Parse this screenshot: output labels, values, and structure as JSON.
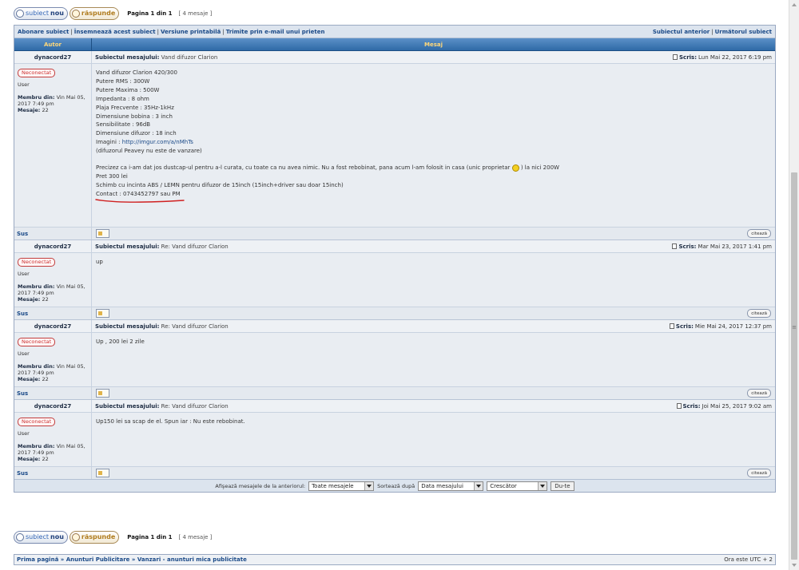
{
  "buttons": {
    "new_topic_w1": "subiect",
    "new_topic_w2": "nou",
    "reply": "răspunde"
  },
  "pagination": "Pagina 1 din 1",
  "message_count": "[ 4 mesaje ]",
  "nav": {
    "subscribe": "Abonare subiect",
    "bookmark": "Însemnează acest subiect",
    "printable": "Versiune printabilă",
    "email": "Trimite prin e-mail unui prieten",
    "prev": "Subiectul anterior",
    "next": "Următorul subiect"
  },
  "headers": {
    "author": "Autor",
    "message": "Mesaj"
  },
  "labels": {
    "subject": "Subiectul mesajului:",
    "written": "Scris:",
    "member_since": "Membru din:",
    "posts": "Mesaje:",
    "top": "Sus",
    "quote": "citează",
    "pm": "🖂"
  },
  "posts": [
    {
      "author": "dynacord27",
      "status": "Neconectat",
      "rank": "User",
      "joined": "Vin Mai 05, 2017 7:49 pm",
      "post_count": "22",
      "subject": "Vand difuzor Clarion",
      "date": "Lun Mai 22, 2017 6:19 pm",
      "lines": [
        "Vand difuzor Clarion 420/300",
        "Putere RMS : 300W",
        "Putere Maxima : 500W",
        "Impedanta : 8 ohm",
        "Plaja Frecvente : 35Hz-1kHz",
        "Dimensiune bobina : 3 inch",
        "Sensibilitate : 96dB",
        "Dimensiune difuzor : 18 inch"
      ],
      "images_label": "Imagini :",
      "images_link": "http://imgur.com/a/nMhTs",
      "note": "(difuzorul Peavey nu este de vanzare)",
      "para_before": "Precizez ca i-am dat jos dustcap-ul pentru a-l curata, cu toate ca nu avea nimic. Nu a fost rebobinat, pana acum l-am folosit in casa (unic proprietar",
      "para_after": ") la nici 200W",
      "price": "Pret 300 lei",
      "swap": "Schimb cu incinta ABS / LEMN pentru difuzor de 15inch (15inch+driver sau doar 15inch)",
      "contact": "Contact : 0743452797 sau PM"
    },
    {
      "author": "dynacord27",
      "status": "Neconectat",
      "rank": "User",
      "joined": "Vin Mai 05, 2017 7:49 pm",
      "post_count": "22",
      "subject": "Re: Vand difuzor Clarion",
      "date": "Mar Mai 23, 2017 1:41 pm",
      "text": "up"
    },
    {
      "author": "dynacord27",
      "status": "Neconectat",
      "rank": "User",
      "joined": "Vin Mai 05, 2017 7:49 pm",
      "post_count": "22",
      "subject": "Re: Vand difuzor Clarion",
      "date": "Mie Mai 24, 2017 12:37 pm",
      "text": "Up , 200 lei 2 zile"
    },
    {
      "author": "dynacord27",
      "status": "Neconectat",
      "rank": "User",
      "joined": "Vin Mai 05, 2017 7:49 pm",
      "post_count": "22",
      "subject": "Re: Vand difuzor Clarion",
      "date": "Joi Mai 25, 2017 9:02 am",
      "text": "Up150 lei sa scap de el. Spun iar : Nu este rebobinat."
    }
  ],
  "sort": {
    "label1": "Afişează mesajele de la anteriorul:",
    "sel1": "Toate mesajele",
    "label2": "Sortează după",
    "sel2": "Data mesajului",
    "sel3": "Crescător",
    "go": "Du-te"
  },
  "breadcrumbs": {
    "home": "Prima pagină",
    "sep": "»",
    "c1": "Anunturi Publicitare",
    "c2": "Vanzari - anunturi mica publicitate",
    "timezone": "Ora este UTC + 2"
  },
  "colors": {
    "header_bar": "#2f6aa7",
    "header_text": "#ffd87a",
    "link": "#1b4a88",
    "offline": "#c33333",
    "underline": "#d02020"
  }
}
